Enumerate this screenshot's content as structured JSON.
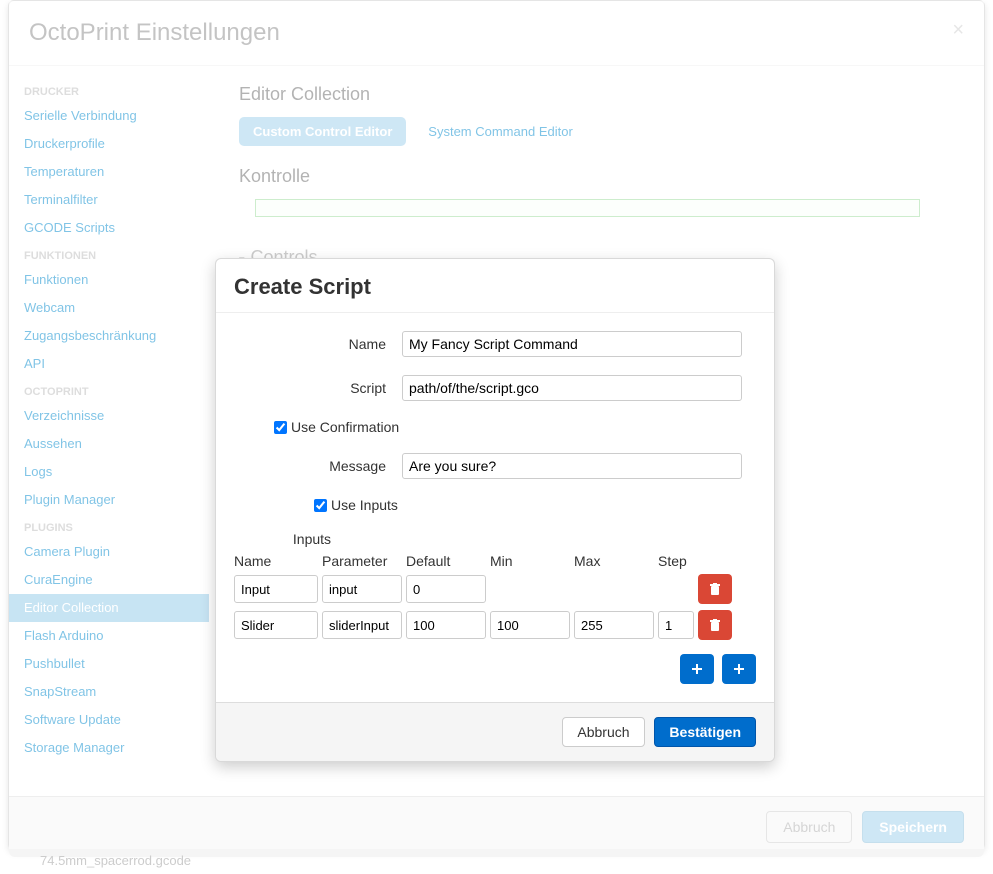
{
  "settings": {
    "title": "OctoPrint Einstellungen",
    "nav": {
      "groups": [
        {
          "header": "DRUCKER",
          "items": [
            "Serielle Verbindung",
            "Druckerprofile",
            "Temperaturen",
            "Terminalfilter",
            "GCODE Scripts"
          ]
        },
        {
          "header": "FUNKTIONEN",
          "items": [
            "Funktionen",
            "Webcam",
            "Zugangsbeschränkung",
            "API"
          ]
        },
        {
          "header": "OCTOPRINT",
          "items": [
            "Verzeichnisse",
            "Aussehen",
            "Logs",
            "Plugin Manager"
          ]
        },
        {
          "header": "PLUGINS",
          "items": [
            "Camera Plugin",
            "CuraEngine",
            "Editor Collection",
            "Flash Arduino",
            "Pushbullet",
            "SnapStream",
            "Software Update",
            "Storage Manager"
          ]
        }
      ],
      "active": "Editor Collection"
    },
    "content": {
      "heading1": "Editor Collection",
      "tab1": "Custom Control Editor",
      "tab2": "System Command Editor",
      "heading2": "Kontrolle",
      "controls_label": "Controls"
    },
    "footer": {
      "cancel": "Abbruch",
      "save": "Speichern"
    }
  },
  "scriptModal": {
    "title": "Create Script",
    "labels": {
      "name": "Name",
      "script": "Script",
      "use_confirmation": "Use Confirmation",
      "message": "Message",
      "use_inputs": "Use Inputs",
      "inputs_heading": "Inputs"
    },
    "values": {
      "name": "My Fancy Script Command",
      "script": "path/of/the/script.gco",
      "use_confirmation": true,
      "message": "Are you sure?",
      "use_inputs": true
    },
    "table": {
      "headers": {
        "name": "Name",
        "parameter": "Parameter",
        "default": "Default",
        "min": "Min",
        "max": "Max",
        "step": "Step"
      },
      "rows": [
        {
          "name": "Input",
          "parameter": "input",
          "default": "0",
          "min": "",
          "max": "",
          "step": "",
          "slider": false
        },
        {
          "name": "Slider",
          "parameter": "sliderInput",
          "default": "100",
          "min": "100",
          "max": "255",
          "step": "1",
          "slider": true
        }
      ]
    },
    "footer": {
      "cancel": "Abbruch",
      "confirm": "Bestätigen"
    }
  },
  "backgroundFile": "74.5mm_spacerrod.gcode"
}
